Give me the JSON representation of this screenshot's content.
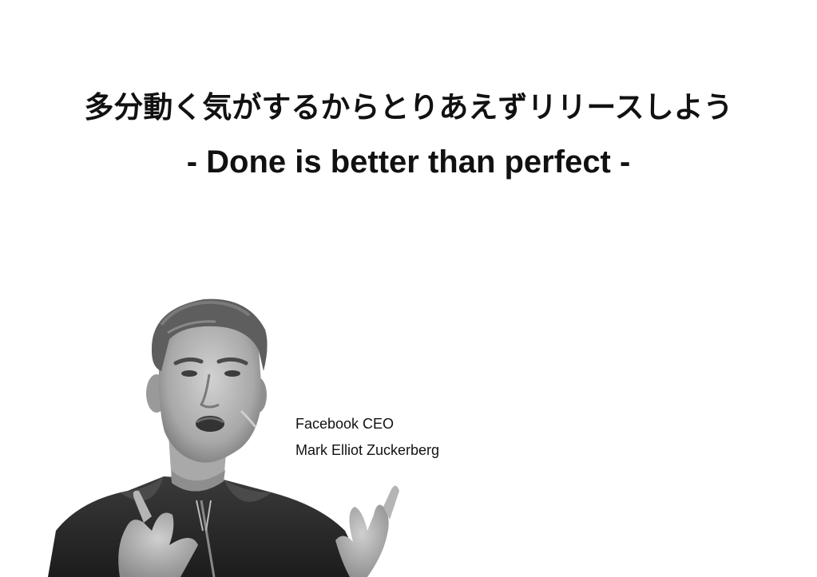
{
  "quote": {
    "japanese": "多分動く気がするからとりあえずリリースしよう",
    "english": "- Done is better than perfect -"
  },
  "attribution": {
    "title": "Facebook CEO",
    "name": "Mark Elliot Zuckerberg"
  },
  "photo": {
    "icon": "speaker-portrait-icon",
    "style": "grayscale"
  }
}
